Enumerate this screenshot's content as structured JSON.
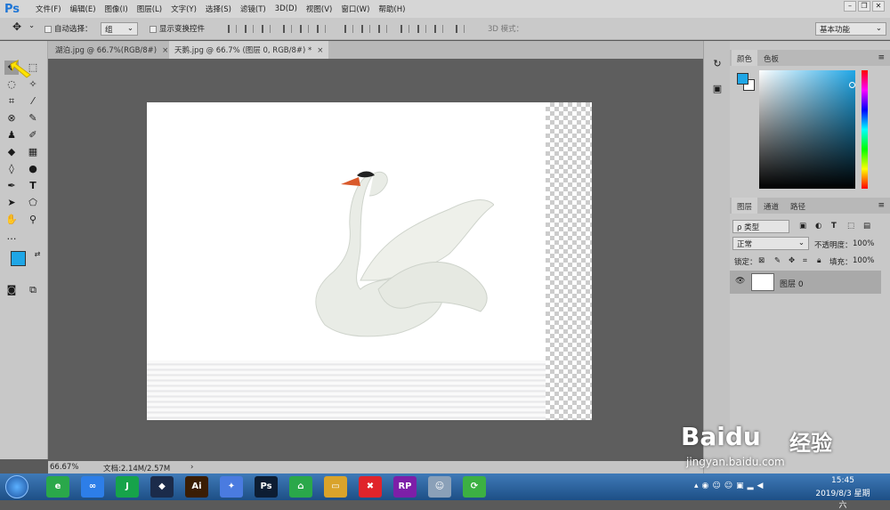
{
  "app": {
    "logo": "Ps"
  },
  "menu": [
    "文件(F)",
    "编辑(E)",
    "图像(I)",
    "图层(L)",
    "文字(Y)",
    "选择(S)",
    "滤镜(T)",
    "3D(D)",
    "视图(V)",
    "窗口(W)",
    "帮助(H)"
  ],
  "options": {
    "auto_select_label": "自动选择：",
    "auto_select_value": "组",
    "show_transform_label": "显示变换控件",
    "mode_3d_label": "3D 模式：",
    "workspace": "基本功能"
  },
  "tabs": [
    {
      "label": "湖泊.jpg @ 66.7%(RGB/8#)",
      "close": "×"
    },
    {
      "label": "天鹅.jpg @ 66.7% (图层 0, RGB/8#) *",
      "close": "×"
    }
  ],
  "status": {
    "zoom": "66.67%",
    "doc": "文档:2.14M/2.57M",
    "arrow": "›"
  },
  "color_panel": {
    "tabs": [
      "颜色",
      "色板"
    ],
    "fg": "#1fa6e6",
    "bg": "#ffffff"
  },
  "layers_panel": {
    "tabs": [
      "图层",
      "通道",
      "路径"
    ],
    "filter_label": "ρ 类型",
    "blend_mode": "正常",
    "opacity_label": "不透明度：",
    "opacity_value": "100%",
    "lock_label": "锁定：",
    "fill_label": "填充：",
    "fill_value": "100%",
    "layer_name": "图层 0"
  },
  "taskbar": {
    "apps": [
      {
        "icon": "chrome-icon",
        "text": "e",
        "color": "#2aa84a"
      },
      {
        "icon": "baidu-cloud-icon",
        "text": "∞",
        "color": "#2d7ee8"
      },
      {
        "icon": "jianying-icon",
        "text": "J",
        "color": "#16a34a"
      },
      {
        "icon": "app-icon",
        "text": "◆",
        "color": "#1b2b4a"
      },
      {
        "icon": "illustrator-icon",
        "text": "Ai",
        "color": "#3a1d04"
      },
      {
        "icon": "bird-icon",
        "text": "✦",
        "color": "#4a7be0"
      },
      {
        "icon": "photoshop-icon",
        "text": "Ps",
        "color": "#0d1d33"
      },
      {
        "icon": "green-app-icon",
        "text": "⌂",
        "color": "#2aa84a"
      },
      {
        "icon": "folder-icon",
        "text": "▭",
        "color": "#d9a32a"
      },
      {
        "icon": "xmind-icon",
        "text": "✖",
        "color": "#e0242b"
      },
      {
        "icon": "axure-rp-icon",
        "text": "RP",
        "color": "#7d1fa8"
      },
      {
        "icon": "avatar-icon",
        "text": "☺",
        "color": "#8aa0b8"
      },
      {
        "icon": "refresh-app-icon",
        "text": "⟳",
        "color": "#3cb043"
      }
    ],
    "time": "15:45",
    "date": "2019/8/3 星期六"
  },
  "watermark": {
    "brand": "Baidu",
    "brand_cn": "经验",
    "url": "jingyan.baidu.com"
  }
}
